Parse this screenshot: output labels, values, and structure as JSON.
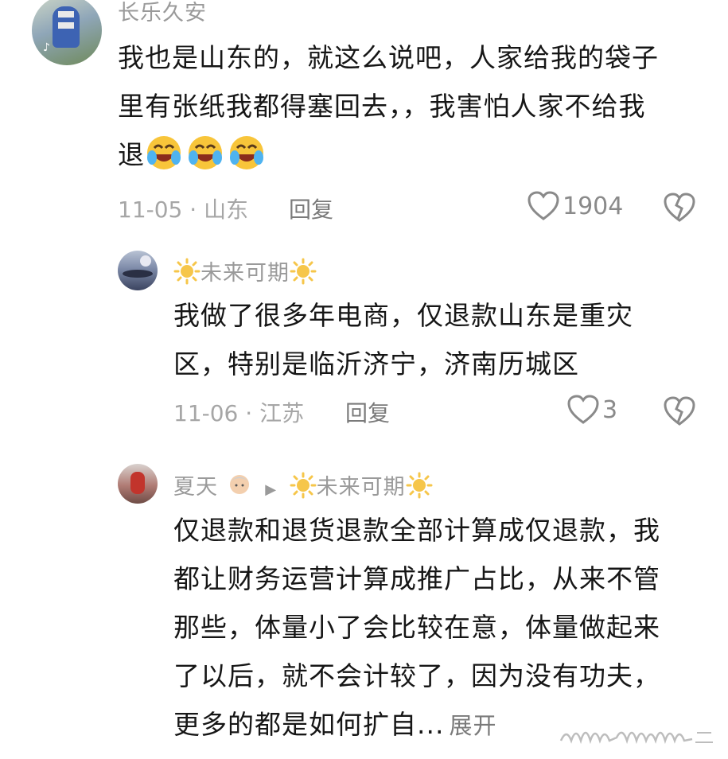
{
  "comments": [
    {
      "username": "长乐久安",
      "lines": [
        "我也是山东的，就这么说吧，人家给我的袋子",
        "里有张纸我都得塞回去，，我害怕人家不给我",
        "退"
      ],
      "date": "11-05",
      "location": "山东",
      "reply": "回复",
      "likes": "1904"
    },
    {
      "username": "未来可期",
      "lines": [
        "我做了很多年电商，仅退款山东是重灾",
        "区，特别是临沂济宁，济南历城区"
      ],
      "date": "11-06",
      "location": "江苏",
      "reply": "回复",
      "likes": "3"
    },
    {
      "username": "夏天",
      "reply_to": "未来可期",
      "lines": [
        "仅退款和退货退款全部计算成仅退款，我",
        "都让财务运营计算成推广占比，从来不管",
        "那些，体量小了会比较在意，体量做起来",
        "了以后，就不会计较了，因为没有功夫，",
        "更多的都是如何扩自..."
      ],
      "expand": "展开"
    }
  ],
  "meta_separator": " · ",
  "colors": {
    "heart": "#8a8a8a",
    "sun": "#f6c64a",
    "text": "#161616",
    "meta": "#a6a6a6"
  }
}
